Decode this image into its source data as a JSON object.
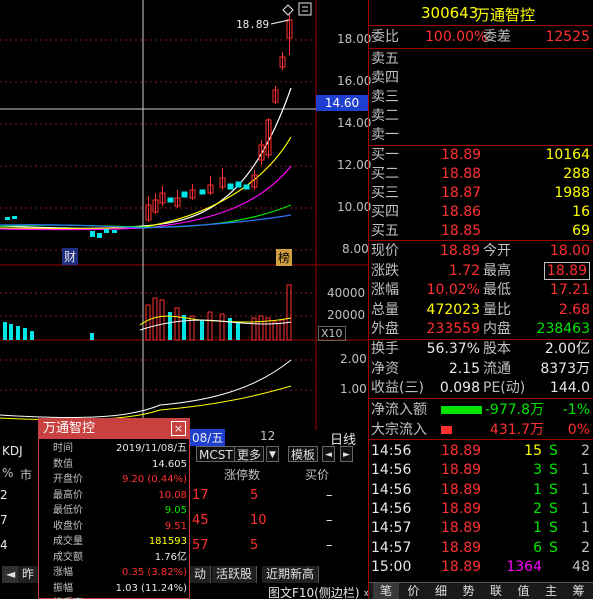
{
  "chart": {
    "price_marker": "18.89",
    "crosshair_price": "14.60",
    "price_axis": [
      "18.00",
      "16.00",
      "14.00",
      "12.00",
      "10.00",
      "8.00"
    ],
    "volume_axis": [
      "40000",
      "20000",
      "X10"
    ],
    "indicator_axis": [
      "2.00",
      "1.00"
    ],
    "kdj_label": "KDJ",
    "tag_cai": "财",
    "tag_bang": "榜",
    "date_label": "08/五",
    "month_label": "12",
    "period_label": "日线",
    "candles": [
      {
        "t": 0,
        "o": 10.62,
        "c": 10.62,
        "h": 10.62,
        "l": 10.62
      },
      {
        "t": 1,
        "o": 10.95,
        "c": 10.95,
        "h": 10.95,
        "l": 10.95
      },
      {
        "t": 2,
        "o": 10.63,
        "c": 10.55,
        "h": 10.7,
        "l": 10.5
      },
      {
        "t": 3,
        "o": 10.48,
        "c": 10.62,
        "h": 10.68,
        "l": 10.42
      }
    ]
  },
  "toolbar": {
    "mcst": "MCST",
    "more": "更多",
    "dropdown": "▼",
    "template": "模板",
    "prev": "◄",
    "next": "►"
  },
  "under_table": {
    "col_limit_up": "涨停数",
    "col_buy": "买价",
    "left_head": "%",
    "left_label": "市",
    "rows": [
      {
        "left": "2",
        "code": "17",
        "count": "5",
        "buy": "–"
      },
      {
        "left": "7",
        "code": "45",
        "count": "10",
        "buy": "–"
      },
      {
        "left": "4",
        "code": "57",
        "count": "5",
        "buy": "–"
      }
    ]
  },
  "bottom_tabs": [
    "昨",
    "动",
    "活跃股",
    "近期新高"
  ],
  "status_bar": "图文F10(侧边栏) »",
  "popup": {
    "title": "万通智控",
    "close": "×",
    "rows": [
      {
        "label": "时间",
        "value": "2019/11/08/五",
        "color": "#e8e8e8"
      },
      {
        "label": "数值",
        "value": "14.605",
        "color": "#e8e8e8"
      },
      {
        "label": "开盘价",
        "value": "9.20 (0.44%)",
        "color": "#ff3030"
      },
      {
        "label": "最高价",
        "value": "10.08",
        "color": "#ff3030"
      },
      {
        "label": "最低价",
        "value": "9.05",
        "color": "#00e600"
      },
      {
        "label": "收盘价",
        "value": "9.51",
        "color": "#ff3030"
      },
      {
        "label": "成交量",
        "value": "181593",
        "color": "#ffff00"
      },
      {
        "label": "成交额",
        "value": "1.76亿",
        "color": "#e8e8e8"
      },
      {
        "label": "涨幅",
        "value": "0.35 (3.82%)",
        "color": "#ff3030"
      },
      {
        "label": "振幅",
        "value": "1.03 (11.24%)",
        "color": "#e8e8e8"
      },
      {
        "label": "换手率",
        "value": "21.69%",
        "color": "#e8e8e8"
      }
    ]
  },
  "quote": {
    "code": "300643",
    "name": "万通智控",
    "weibi_label": "委比",
    "weibi_value": "100.00%",
    "weicha_label": "委差",
    "weicha_value": "12525",
    "asks": [
      {
        "label": "卖五",
        "price": "",
        "vol": ""
      },
      {
        "label": "卖四",
        "price": "",
        "vol": ""
      },
      {
        "label": "卖三",
        "price": "",
        "vol": ""
      },
      {
        "label": "卖二",
        "price": "",
        "vol": ""
      },
      {
        "label": "卖一",
        "price": "",
        "vol": ""
      }
    ],
    "bids": [
      {
        "label": "买一",
        "price": "18.89",
        "vol": "10164"
      },
      {
        "label": "买二",
        "price": "18.88",
        "vol": "288"
      },
      {
        "label": "买三",
        "price": "18.87",
        "vol": "1988"
      },
      {
        "label": "买四",
        "price": "18.86",
        "vol": "16"
      },
      {
        "label": "买五",
        "price": "18.85",
        "vol": "69"
      }
    ],
    "stats": [
      {
        "l1": "现价",
        "v1": "18.89",
        "c1": "#ff3030",
        "l2": "今开",
        "v2": "18.00",
        "c2": "#ff3030"
      },
      {
        "l1": "涨跌",
        "v1": "1.72",
        "c1": "#ff3030",
        "l2": "最高",
        "v2": "18.89",
        "c2": "#ff3030"
      },
      {
        "l1": "涨幅",
        "v1": "10.02%",
        "c1": "#ff3030",
        "l2": "最低",
        "v2": "17.21",
        "c2": "#ff3030"
      },
      {
        "l1": "总量",
        "v1": "472023",
        "c1": "#ffff00",
        "l2": "量比",
        "v2": "2.68",
        "c2": "#ff3030"
      },
      {
        "l1": "外盘",
        "v1": "233559",
        "c1": "#ff3030",
        "l2": "内盘",
        "v2": "238463",
        "c2": "#00e600"
      }
    ],
    "fund": [
      {
        "l1": "换手",
        "v1": "56.37%",
        "l2": "股本",
        "v2": "2.00亿"
      },
      {
        "l1": "净资",
        "v1": "2.15",
        "l2": "流通",
        "v2": "8373万"
      },
      {
        "l1": "收益(三)",
        "v1": "0.098",
        "l2": "PE(动)",
        "v2": "144.0"
      }
    ],
    "flows": [
      {
        "label": "净流入额",
        "value": "-977.8万",
        "pct": "-1%",
        "color": "#00e600",
        "fill": 0.85
      },
      {
        "label": "大宗流入",
        "value": "431.7万",
        "pct": "0%",
        "color": "#ff3030",
        "fill": 0.22
      }
    ],
    "ticks": [
      {
        "time": "14:56",
        "price": "18.89",
        "vol": "15",
        "side": "S",
        "n": "2",
        "vcolor": "#ffff00"
      },
      {
        "time": "14:56",
        "price": "18.89",
        "vol": "3",
        "side": "S",
        "n": "1",
        "vcolor": "#00e600"
      },
      {
        "time": "14:56",
        "price": "18.89",
        "vol": "1",
        "side": "S",
        "n": "1",
        "vcolor": "#00e600"
      },
      {
        "time": "14:56",
        "price": "18.89",
        "vol": "2",
        "side": "S",
        "n": "1",
        "vcolor": "#00e600"
      },
      {
        "time": "14:57",
        "price": "18.89",
        "vol": "1",
        "side": "S",
        "n": "1",
        "vcolor": "#00e600"
      },
      {
        "time": "14:57",
        "price": "18.89",
        "vol": "6",
        "side": "S",
        "n": "2",
        "vcolor": "#00e600"
      },
      {
        "time": "15:00",
        "price": "18.89",
        "vol": "1364",
        "side": "",
        "n": "48",
        "vcolor": "#ff00ff"
      }
    ],
    "bottom_tabs": [
      "笔",
      "价",
      "细",
      "势",
      "联",
      "值",
      "主",
      "筹"
    ]
  }
}
